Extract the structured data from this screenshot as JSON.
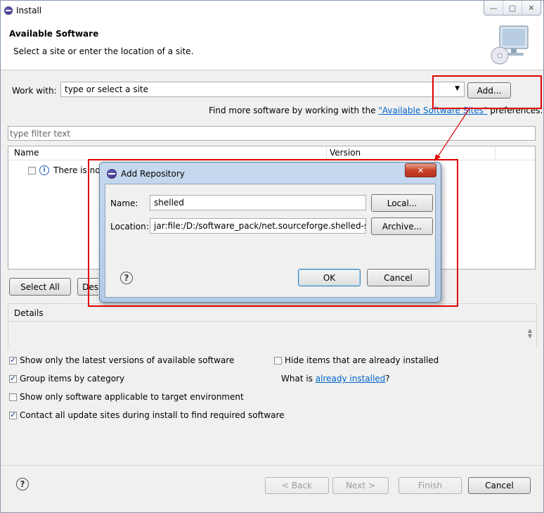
{
  "window": {
    "title": "Install",
    "controls": {
      "minimize": "—",
      "maximize": "▢",
      "close": "✕"
    }
  },
  "header": {
    "title": "Available Software",
    "subtitle": "Select a site or enter the location of a site."
  },
  "work_with": {
    "label": "Work with:",
    "value": "type or select a site",
    "add_button": "Add...",
    "hint_prefix": "Find more software by working with the ",
    "hint_link": "\"Available Software Sites\"",
    "hint_suffix": " preferences."
  },
  "filter": {
    "placeholder": "type filter text"
  },
  "table": {
    "columns": [
      "Name",
      "Version"
    ],
    "rows": [
      {
        "label": "There is no"
      }
    ]
  },
  "selection_buttons": {
    "select_all": "Select All",
    "deselect_all_partial": "Des"
  },
  "details": {
    "label": "Details"
  },
  "options": {
    "latest_versions": {
      "label": "Show only the latest versions of available software",
      "checked": true
    },
    "group_by_category": {
      "label": "Group items by category",
      "checked": true
    },
    "target_env": {
      "label": "Show only software applicable to target environment",
      "checked": false
    },
    "contact_sites": {
      "label": "Contact all update sites during install to find required software",
      "checked": true
    },
    "hide_installed": {
      "label": "Hide items that are already installed",
      "checked": false
    },
    "what_is_prefix": "What is ",
    "what_is_link": "already installed",
    "what_is_suffix": "?"
  },
  "footer": {
    "back": "< Back",
    "next": "Next >",
    "finish": "Finish",
    "cancel": "Cancel"
  },
  "dialog": {
    "title": "Add Repository",
    "close": "✕",
    "name_label": "Name:",
    "name_value": "shelled",
    "location_label": "Location:",
    "location_value": "jar:file:/D:/software_pack/net.sourceforge.shelled-sit",
    "local_button": "Local...",
    "archive_button": "Archive...",
    "ok": "OK",
    "cancel": "Cancel"
  },
  "colors": {
    "highlight": "#e00000",
    "link": "#0066cc"
  }
}
